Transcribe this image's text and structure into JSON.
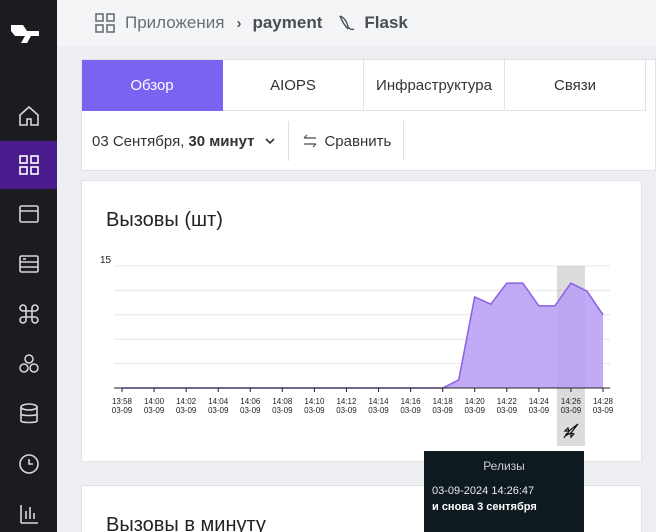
{
  "breadcrumb": {
    "apps": "Приложения",
    "service": "payment",
    "framework": "Flask"
  },
  "tabs": [
    {
      "label": "Обзор",
      "active": true
    },
    {
      "label": "AIOPS",
      "active": false
    },
    {
      "label": "Инфраструктура",
      "active": false
    },
    {
      "label": "Связи",
      "active": false
    }
  ],
  "controls": {
    "date_prefix": "03 Сентября,",
    "date_range": "30 минут",
    "compare_label": "Сравнить"
  },
  "chart_card": {
    "title": "Вызовы (шт)"
  },
  "chart_card2": {
    "title": "Вызовы в минуту"
  },
  "colors": {
    "sidebar_bg": "#1b1c1f",
    "sidebar_active": "#4a1b8c",
    "tab_active": "#7a63f0",
    "area_fill": "#b69cf5",
    "area_line": "#8a5fe6",
    "tooltip_bg": "#0f1a20"
  },
  "tooltip": {
    "title": "Релизы",
    "line1": "03-09-2024 14:26:47",
    "line2": "и снова 3 сентября"
  },
  "chart_data": {
    "type": "area",
    "title": "Вызовы (шт)",
    "ymax_label": "15",
    "ylim": [
      0,
      15
    ],
    "grid": true,
    "x": [
      "13:58",
      "14:00",
      "14:02",
      "14:04",
      "14:06",
      "14:08",
      "14:10",
      "14:12",
      "14:14",
      "14:16",
      "14:18",
      "14:20",
      "14:22",
      "14:24",
      "14:26",
      "14:28"
    ],
    "x_date": "03-09",
    "points": [
      [
        0,
        0
      ],
      [
        1,
        0
      ],
      [
        2,
        0
      ],
      [
        3,
        0
      ],
      [
        4,
        0
      ],
      [
        5,
        0
      ],
      [
        6,
        0
      ],
      [
        7,
        0
      ],
      [
        8,
        0
      ],
      [
        9,
        0
      ],
      [
        10,
        0
      ],
      [
        10.5,
        1
      ],
      [
        11,
        11.2
      ],
      [
        11.5,
        10.3
      ],
      [
        12,
        12.9
      ],
      [
        12.5,
        12.9
      ],
      [
        13,
        10.1
      ],
      [
        13.5,
        10.1
      ],
      [
        14,
        12.9
      ],
      [
        14.5,
        11.9
      ],
      [
        15,
        9
      ]
    ],
    "release_marker_x": 14
  }
}
